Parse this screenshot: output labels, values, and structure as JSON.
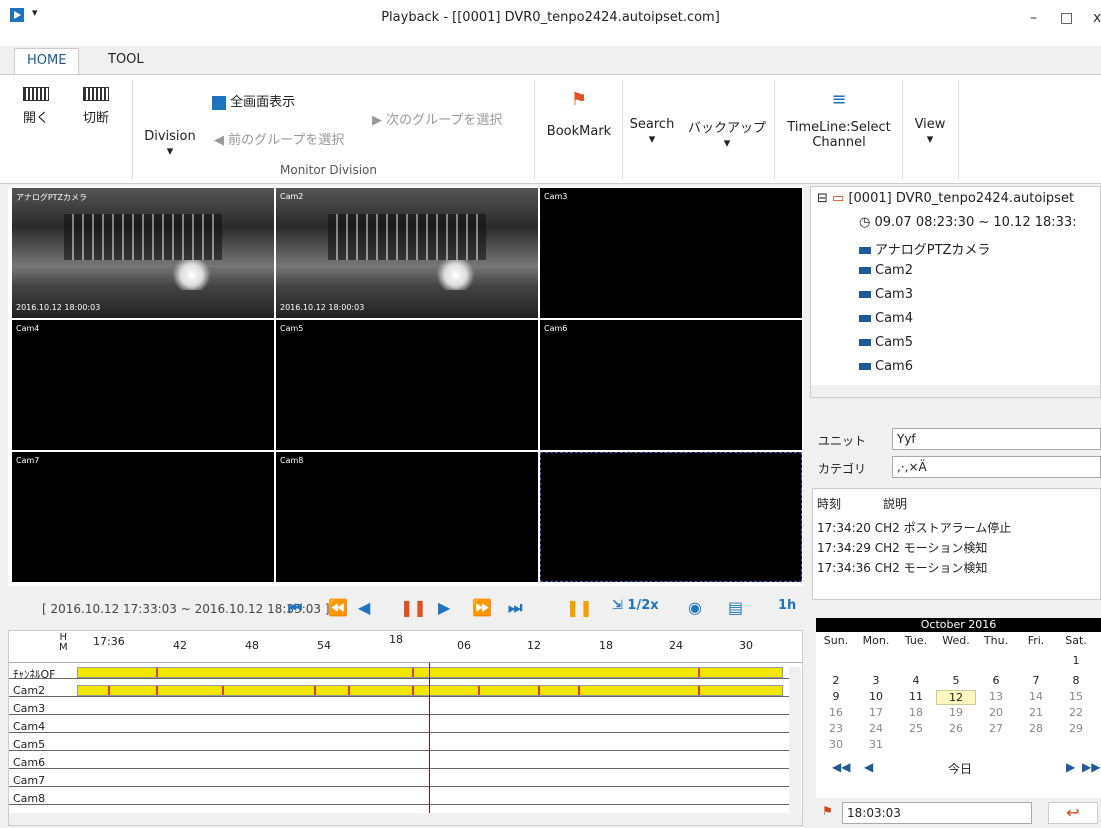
{
  "window": {
    "title": "Playback - [[0001] DVR0_tenpo2424.autoipset.com]",
    "min": "–",
    "max": "□",
    "close": "x"
  },
  "tabs": {
    "home": "HOME",
    "tool": "TOOL"
  },
  "ribbon": {
    "open": "開く",
    "disconnect": "切断",
    "division": "Division",
    "fullscreen": "全画面表示",
    "next_group": "次のグループを選択",
    "prev_group": "前のグループを選択",
    "group_label": "Monitor Division",
    "bookmark": "BookMark",
    "search": "Search",
    "backup": "バックアップ",
    "timeline_select": "TimeLine:Select",
    "channel": "Channel",
    "view": "View"
  },
  "cells": [
    {
      "label": "アナログPTZカメラ",
      "timestamp": "2016.10.12 18:00:03"
    },
    {
      "label": "Cam2",
      "timestamp": "2016.10.12 18:00:03"
    },
    {
      "label": "Cam3",
      "timestamp": ""
    },
    {
      "label": "Cam4",
      "timestamp": ""
    },
    {
      "label": "Cam5",
      "timestamp": ""
    },
    {
      "label": "Cam6",
      "timestamp": ""
    },
    {
      "label": "Cam7",
      "timestamp": ""
    },
    {
      "label": "Cam8",
      "timestamp": ""
    },
    {
      "label": "",
      "timestamp": ""
    }
  ],
  "playbar": {
    "range": "[ 2016.10.12 17:33:03 ~ 2016.10.12 18:33:03 ]",
    "speed": "1/2x",
    "span": "1h"
  },
  "timeline": {
    "hm": "H\nM",
    "ticks": [
      "17:36",
      "42",
      "48",
      "54",
      "18",
      "06",
      "12",
      "18",
      "24",
      "30"
    ],
    "rows": [
      "ﾁｬﾝﾈﾙOF",
      "Cam2",
      "Cam3",
      "Cam4",
      "Cam5",
      "Cam6",
      "Cam7",
      "Cam8"
    ]
  },
  "tree": {
    "root": "[0001] DVR0_tenpo2424.autoipset",
    "range": "09.07 08:23:30 ~ 10.12 18:33:",
    "cams": [
      "アナログPTZカメラ",
      "Cam2",
      "Cam3",
      "Cam4",
      "Cam5",
      "Cam6"
    ]
  },
  "filter": {
    "unit_label": "ユニット",
    "unit_value": "Yyf",
    "category_label": "カテゴリ",
    "category_value": ",·,×Ä"
  },
  "events": {
    "col_time": "時刻",
    "col_desc": "説明",
    "rows": [
      {
        "time": "17:34:20",
        "desc": "CH2 ポストアラーム停止"
      },
      {
        "time": "17:34:29",
        "desc": "CH2 モーション検知"
      },
      {
        "time": "17:34:36",
        "desc": "CH2 モーション検知"
      }
    ]
  },
  "calendar": {
    "month": "October 2016",
    "dow": [
      "Sun.",
      "Mon.",
      "Tue.",
      "Wed.",
      "Thu.",
      "Fri.",
      "Sat."
    ],
    "today_label": "今日",
    "time_value": "18:03:03"
  },
  "colors": {
    "accent": "#1e73be",
    "timeline_bar": "#f0e600",
    "event_mark": "#d04010"
  }
}
